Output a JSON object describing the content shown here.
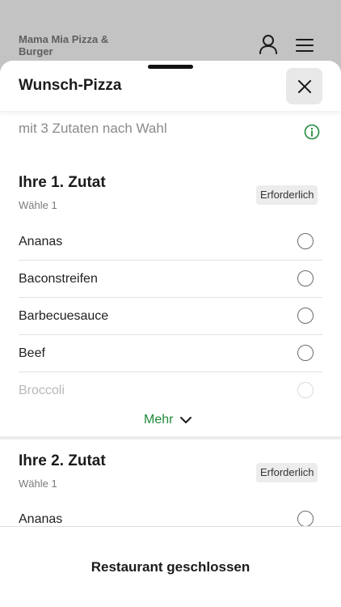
{
  "background": {
    "restaurant_name": "Mama Mia Pizza & Burger",
    "icons": [
      "user-icon",
      "menu-icon"
    ]
  },
  "sheet": {
    "title": "Wunsch-Pizza",
    "close_icon": "close-icon"
  },
  "product": {
    "description": "mit 3 Zutaten nach Wahl",
    "info_icon": "info-icon"
  },
  "sections": [
    {
      "title": "Ihre 1. Zutat",
      "subtitle": "Wähle 1",
      "badge": "Erforderlich",
      "options": [
        "Ananas",
        "Baconstreifen",
        "Barbecuesauce",
        "Beef",
        "Broccoli"
      ],
      "more_label": "Mehr"
    },
    {
      "title": "Ihre 2. Zutat",
      "subtitle": "Wähle 1",
      "badge": "Erforderlich",
      "options": [
        "Ananas"
      ]
    }
  ],
  "footer": {
    "status": "Restaurant geschlossen"
  },
  "colors": {
    "accent_green": "#1f8a3b",
    "badge_bg": "#ececec",
    "overlay_gray": "#c3c3c3"
  }
}
